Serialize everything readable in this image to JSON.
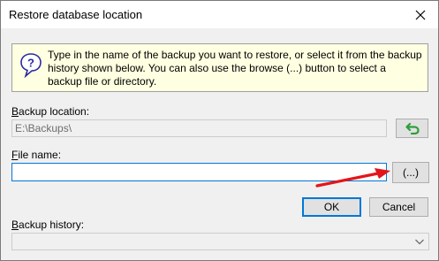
{
  "window": {
    "title": "Restore database location"
  },
  "info": {
    "text": "Type in the name of the backup you want to restore, or select it from the backup history shown below.  You can also use the browse  (...)  button to select a backup file or directory."
  },
  "backup_location": {
    "label_accel": "B",
    "label_rest": "ackup location:",
    "value": "E:\\Backups\\"
  },
  "file_name": {
    "label_accel": "F",
    "label_rest": "ile name:",
    "value": "",
    "browse_label": "(...)"
  },
  "buttons": {
    "ok": "OK",
    "cancel": "Cancel"
  },
  "backup_history": {
    "label_accel": "B",
    "label_rest": "ackup history:",
    "selected": ""
  },
  "colors": {
    "info_bg": "#ffffe1",
    "accent_blue": "#0078d7",
    "arrow_red": "#e3151a",
    "reset_green": "#2e9e3a"
  },
  "icons": {
    "close": "close-icon",
    "help": "question-mark-icon",
    "reset": "undo-arrow-icon",
    "dropdown": "chevron-down-icon"
  }
}
